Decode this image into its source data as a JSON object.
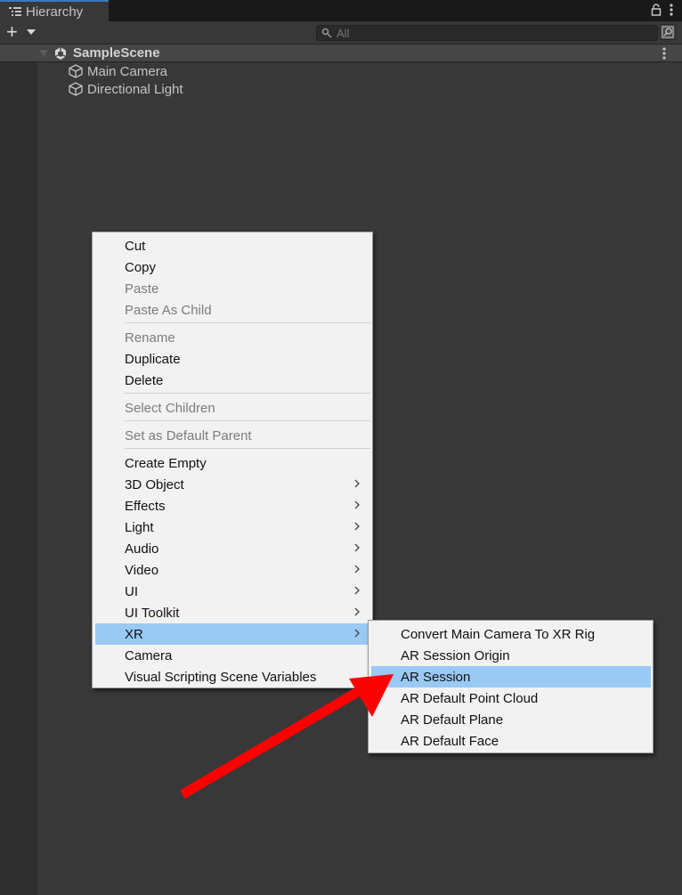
{
  "window": {
    "tab_title": "Hierarchy"
  },
  "toolbar": {
    "search_placeholder": "All"
  },
  "scene": {
    "name": "SampleScene"
  },
  "hierarchy": {
    "items": [
      {
        "label": "Main Camera",
        "icon": "gameobject-cube-icon"
      },
      {
        "label": "Directional Light",
        "icon": "gameobject-cube-icon"
      }
    ]
  },
  "context_menu": {
    "items": [
      {
        "label": "Cut",
        "enabled": true
      },
      {
        "label": "Copy",
        "enabled": true
      },
      {
        "label": "Paste",
        "enabled": false
      },
      {
        "label": "Paste As Child",
        "enabled": false
      },
      {
        "label": "Rename",
        "enabled": false
      },
      {
        "label": "Duplicate",
        "enabled": true
      },
      {
        "label": "Delete",
        "enabled": true
      },
      {
        "label": "Select Children",
        "enabled": false
      },
      {
        "label": "Set as Default Parent",
        "enabled": false
      },
      {
        "label": "Create Empty",
        "enabled": true
      },
      {
        "label": "3D Object",
        "enabled": true,
        "submenu": true
      },
      {
        "label": "Effects",
        "enabled": true,
        "submenu": true
      },
      {
        "label": "Light",
        "enabled": true,
        "submenu": true
      },
      {
        "label": "Audio",
        "enabled": true,
        "submenu": true
      },
      {
        "label": "Video",
        "enabled": true,
        "submenu": true
      },
      {
        "label": "UI",
        "enabled": true,
        "submenu": true
      },
      {
        "label": "UI Toolkit",
        "enabled": true,
        "submenu": true
      },
      {
        "label": "XR",
        "enabled": true,
        "submenu": true,
        "highlighted": true
      },
      {
        "label": "Camera",
        "enabled": true
      },
      {
        "label": "Visual Scripting Scene Variables",
        "enabled": true
      }
    ]
  },
  "xr_submenu": {
    "items": [
      {
        "label": "Convert Main Camera To XR Rig"
      },
      {
        "label": "AR Session Origin"
      },
      {
        "label": "AR Session",
        "highlighted": true
      },
      {
        "label": "AR Default Point Cloud"
      },
      {
        "label": "AR Default Plane"
      },
      {
        "label": "AR Default Face"
      }
    ]
  },
  "colors": {
    "highlight": "#99c9f5",
    "annotation_arrow": "#ff0000",
    "tab_accent": "#3a79bb"
  }
}
